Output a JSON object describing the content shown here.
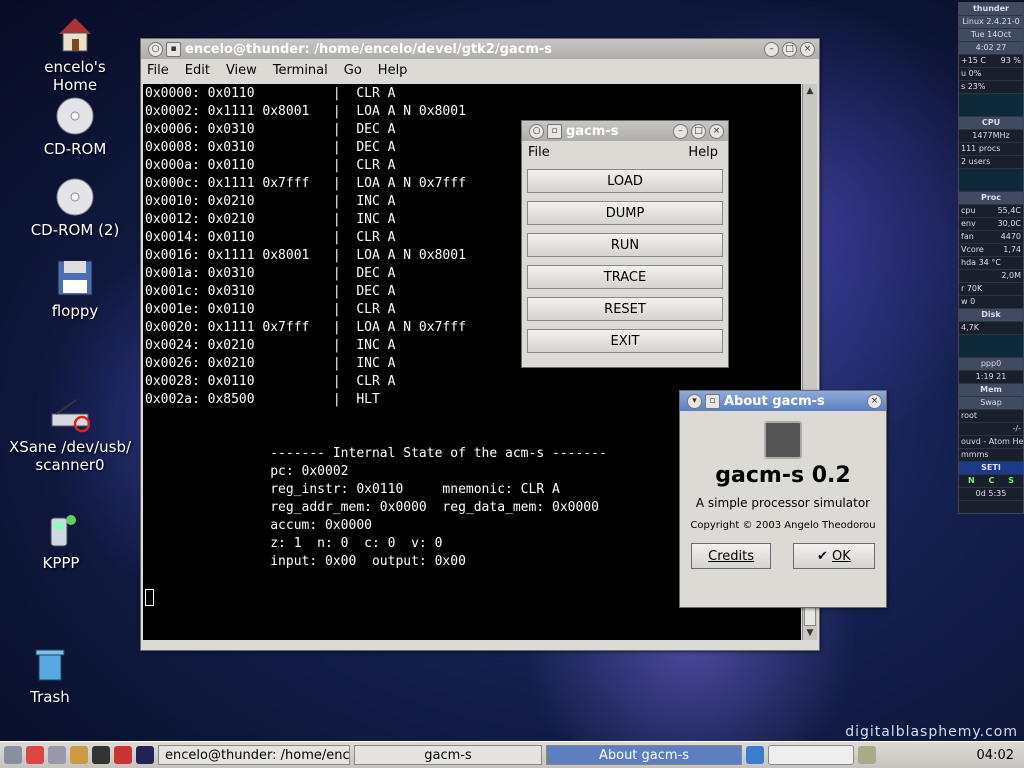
{
  "watermark": "digitalblasphemy.com",
  "desktop_icons": [
    {
      "label": "encelo's Home",
      "icon": "home-icon"
    },
    {
      "label": "CD-ROM",
      "icon": "cdrom-icon"
    },
    {
      "label": "CD-ROM (2)",
      "icon": "cdrom-icon"
    },
    {
      "label": "floppy",
      "icon": "floppy-icon"
    },
    {
      "label_line1": "XSane /dev/usb/",
      "label_line2": "scanner0",
      "icon": "scanner-icon"
    },
    {
      "label": "KPPP",
      "icon": "kppp-icon"
    },
    {
      "label": "Trash",
      "icon": "trash-icon"
    }
  ],
  "terminal_window": {
    "title": "encelo@thunder: /home/encelo/devel/gtk2/gacm-s",
    "menu": [
      "File",
      "Edit",
      "View",
      "Terminal",
      "Go",
      "Help"
    ],
    "lines": [
      "0x0000: 0x0110          |  CLR A",
      "0x0002: 0x1111 0x8001   |  LOA A N 0x8001",
      "0x0006: 0x0310          |  DEC A",
      "0x0008: 0x0310          |  DEC A",
      "0x000a: 0x0110          |  CLR A",
      "0x000c: 0x1111 0x7fff   |  LOA A N 0x7fff",
      "0x0010: 0x0210          |  INC A",
      "0x0012: 0x0210          |  INC A",
      "0x0014: 0x0110          |  CLR A",
      "0x0016: 0x1111 0x8001   |  LOA A N 0x8001",
      "0x001a: 0x0310          |  DEC A",
      "0x001c: 0x0310          |  DEC A",
      "0x001e: 0x0110          |  CLR A",
      "0x0020: 0x1111 0x7fff   |  LOA A N 0x7fff",
      "0x0024: 0x0210          |  INC A",
      "0x0026: 0x0210          |  INC A",
      "0x0028: 0x0110          |  CLR A",
      "0x002a: 0x8500          |  HLT",
      "",
      "",
      "                ------- Internal State of the acm-s -------",
      "                pc: 0x0002",
      "                reg_instr: 0x0110     mnemonic: CLR A",
      "                reg_addr_mem: 0x0000  reg_data_mem: 0x0000",
      "                accum: 0x0000",
      "                z: 1  n: 0  c: 0  v: 0",
      "                input: 0x00  output: 0x00"
    ]
  },
  "gacm_window": {
    "title": "gacm-s",
    "menu_left": "File",
    "menu_right": "Help",
    "buttons": [
      "LOAD",
      "DUMP",
      "RUN",
      "TRACE",
      "RESET",
      "EXIT"
    ]
  },
  "about_dialog": {
    "title": "About gacm-s",
    "app_name": "gacm-s 0.2",
    "description": "A simple processor simulator",
    "copyright": "Copyright © 2003 Angelo Theodorou",
    "credits_label": "Credits",
    "ok_label": "OK"
  },
  "conky": {
    "host": "thunder",
    "kernel": "Linux 2.4.21-0",
    "date": "Tue 14Oct",
    "time": "4:02 27",
    "temp": "+15 C",
    "humidity": "93 %",
    "u_pct": "u 0%",
    "s_pct": "s 23%",
    "cpu_header": "CPU",
    "cpu_freq": "1477MHz",
    "procs": "111 procs",
    "users": "2 users",
    "proc_header": "Proc",
    "cpu_temp_label": "cpu",
    "cpu_temp": "55,4C",
    "env_label": "env",
    "env_temp": "30,0C",
    "fan_label": "fan",
    "fan": "4470",
    "vcore_label": "Vcore",
    "vcore": "1,74",
    "hda": "hda  34 °C",
    "mem_total": "2,0M",
    "r_label": "r 70K",
    "w_label": "w 0",
    "disk_header": "Disk",
    "disk_val": "4,7K",
    "ppp": "ppp0",
    "uptime": "1:19 21",
    "mem_header": "Mem",
    "swap_header": "Swap",
    "root": "root",
    "mail": "-/-",
    "audio": "ouvd - Atom Hea",
    "mms": "mmms",
    "seti": "SETI",
    "ncs": [
      "N",
      "C",
      "S"
    ],
    "seti_time": "0d 5:35"
  },
  "taskbar": {
    "tasks": [
      {
        "label": "encelo@thunder: /home/encel",
        "active": false
      },
      {
        "label": "gacm-s",
        "active": false
      },
      {
        "label": "About gacm-s",
        "active": true
      }
    ],
    "clock": "04:02"
  }
}
